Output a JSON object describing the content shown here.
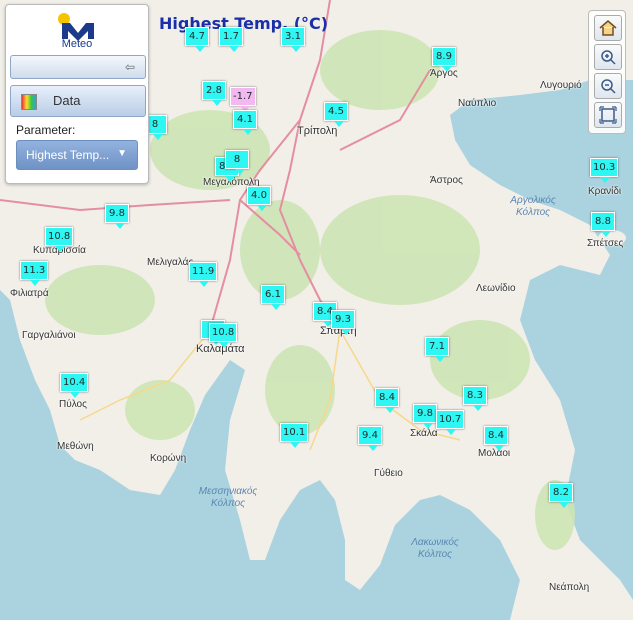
{
  "title": "Highest Temp. (°C)",
  "panel": {
    "logo_text": "Meteo",
    "data_button": "Data",
    "parameter_label": "Parameter:",
    "parameter_value": "Highest Temp..."
  },
  "colors": {
    "station": "#2ef6f2",
    "station_negative": "#f3b8ef",
    "title": "#1a2fa8",
    "land": "#f2efe9",
    "sea": "#aad3df",
    "forest": "#cde5b5",
    "road": "#e58ea0"
  },
  "stations": [
    {
      "name": "s-1",
      "value": "4.7",
      "c": "c"
    },
    {
      "name": "s-2",
      "value": "1.7",
      "c": "c"
    },
    {
      "name": "s-3",
      "value": "3.1",
      "c": "c"
    },
    {
      "name": "s-4",
      "value": "8.9",
      "c": "c"
    },
    {
      "name": "s-5",
      "value": "2.8",
      "c": "c"
    },
    {
      "name": "s-6",
      "value": "-1.7",
      "c": "p"
    },
    {
      "name": "s-7",
      "value": "4.1",
      "c": "c"
    },
    {
      "name": "s-8",
      "value": "4.5",
      "c": "c"
    },
    {
      "name": "s-9",
      "value": "8",
      "c": "c"
    },
    {
      "name": "s-10",
      "value": "8.2",
      "c": "c"
    },
    {
      "name": "s-11",
      "value": "8",
      "c": "c"
    },
    {
      "name": "s-12",
      "value": "4.0",
      "c": "c"
    },
    {
      "name": "s-13",
      "value": "10.3",
      "c": "c"
    },
    {
      "name": "s-14",
      "value": "8.8",
      "c": "c"
    },
    {
      "name": "s-15",
      "value": "9.8",
      "c": "c"
    },
    {
      "name": "s-16",
      "value": "10.8",
      "c": "c"
    },
    {
      "name": "s-17",
      "value": "11.3",
      "c": "c"
    },
    {
      "name": "s-18",
      "value": "11.9",
      "c": "c"
    },
    {
      "name": "s-19",
      "value": "6.1",
      "c": "c"
    },
    {
      "name": "s-20",
      "value": "8.4",
      "c": "c"
    },
    {
      "name": "s-21",
      "value": "9.3",
      "c": "c"
    },
    {
      "name": "s-22",
      "value": "1",
      "c": "c"
    },
    {
      "name": "s-23",
      "value": "10.8",
      "c": "c"
    },
    {
      "name": "s-24",
      "value": "7.1",
      "c": "c"
    },
    {
      "name": "s-25",
      "value": "10.4",
      "c": "c"
    },
    {
      "name": "s-26",
      "value": "8.4",
      "c": "c"
    },
    {
      "name": "s-27",
      "value": "8.3",
      "c": "c"
    },
    {
      "name": "s-28",
      "value": "9.8",
      "c": "c"
    },
    {
      "name": "s-29",
      "value": "10.7",
      "c": "c"
    },
    {
      "name": "s-30",
      "value": "8.4",
      "c": "c"
    },
    {
      "name": "s-31",
      "value": "10.1",
      "c": "c"
    },
    {
      "name": "s-32",
      "value": "9.4",
      "c": "c"
    },
    {
      "name": "s-33",
      "value": "8.2",
      "c": "c"
    }
  ],
  "places": [
    "Άργος",
    "Λυγουριό",
    "Ναύπλιο",
    "Τρίπολη",
    "Μεγαλόπολη",
    "Άστρος",
    "Κρανίδι",
    "Αργολικός Κόλπος",
    "Σπέτσες",
    "Κυπαρισσία",
    "Μελιγαλάς",
    "Λεωνίδιο",
    "Φιλιατρά",
    "Γαργαλιάνοι",
    "Καλαμάτα",
    "Σπάρτη",
    "Πύλος",
    "Σκάλα",
    "Μολάοι",
    "Μεθώνη",
    "Κορώνη",
    "Γύθειο",
    "Μεσσηνιακός Κόλπος",
    "Λακωνικός Κόλπος",
    "Νεάπολη"
  ]
}
